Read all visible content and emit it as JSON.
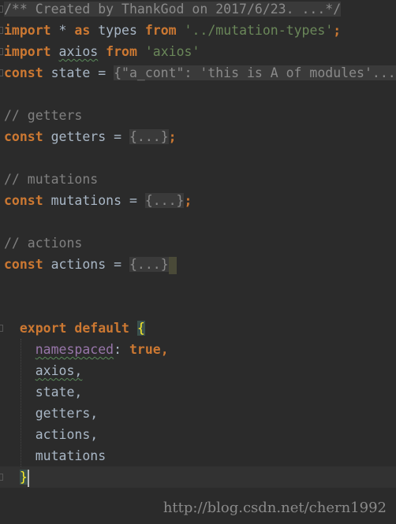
{
  "code": {
    "comment_header": "/** Created by ThankGod on 2017/6/23. ...*/",
    "line_import_types": {
      "kw1": "import",
      "star": " * ",
      "kw2": "as",
      "name": " types ",
      "kw3": "from",
      "str": " '../mutation-types'",
      "end": ";"
    },
    "line_import_axios": {
      "kw1": "import",
      "name": "axios",
      "kw2": "from",
      "str": "'axios'"
    },
    "line_state": {
      "kw": "const",
      "name": " state = ",
      "folded": "{\"a_cont\": 'this is A of modules'..."
    },
    "comment_getters": "// getters",
    "line_getters": {
      "kw": "const",
      "name": " getters = ",
      "folded": "{...}",
      "end": ";"
    },
    "comment_mutations": "// mutations",
    "line_mutations": {
      "kw": "const",
      "name": " mutations = ",
      "folded": "{...}",
      "end": ";"
    },
    "comment_actions": "// actions",
    "line_actions": {
      "kw": "const",
      "name": " actions = ",
      "folded": "{...}"
    },
    "export": {
      "kw1": "export",
      "kw2": "default",
      "open": "{",
      "close": "}"
    },
    "export_body": {
      "namespaced": "namespaced",
      "colon": ": ",
      "true_kw": "true",
      "comma": ",",
      "items": [
        "axios,",
        "state,",
        "getters,",
        "actions,",
        "mutations"
      ]
    }
  },
  "watermark": "http://blog.csdn.net/chern1992",
  "colors": {
    "background": "#2b2b2b",
    "keyword": "#cc7832",
    "string": "#6a8759",
    "comment": "#808080",
    "property": "#9876aa"
  }
}
